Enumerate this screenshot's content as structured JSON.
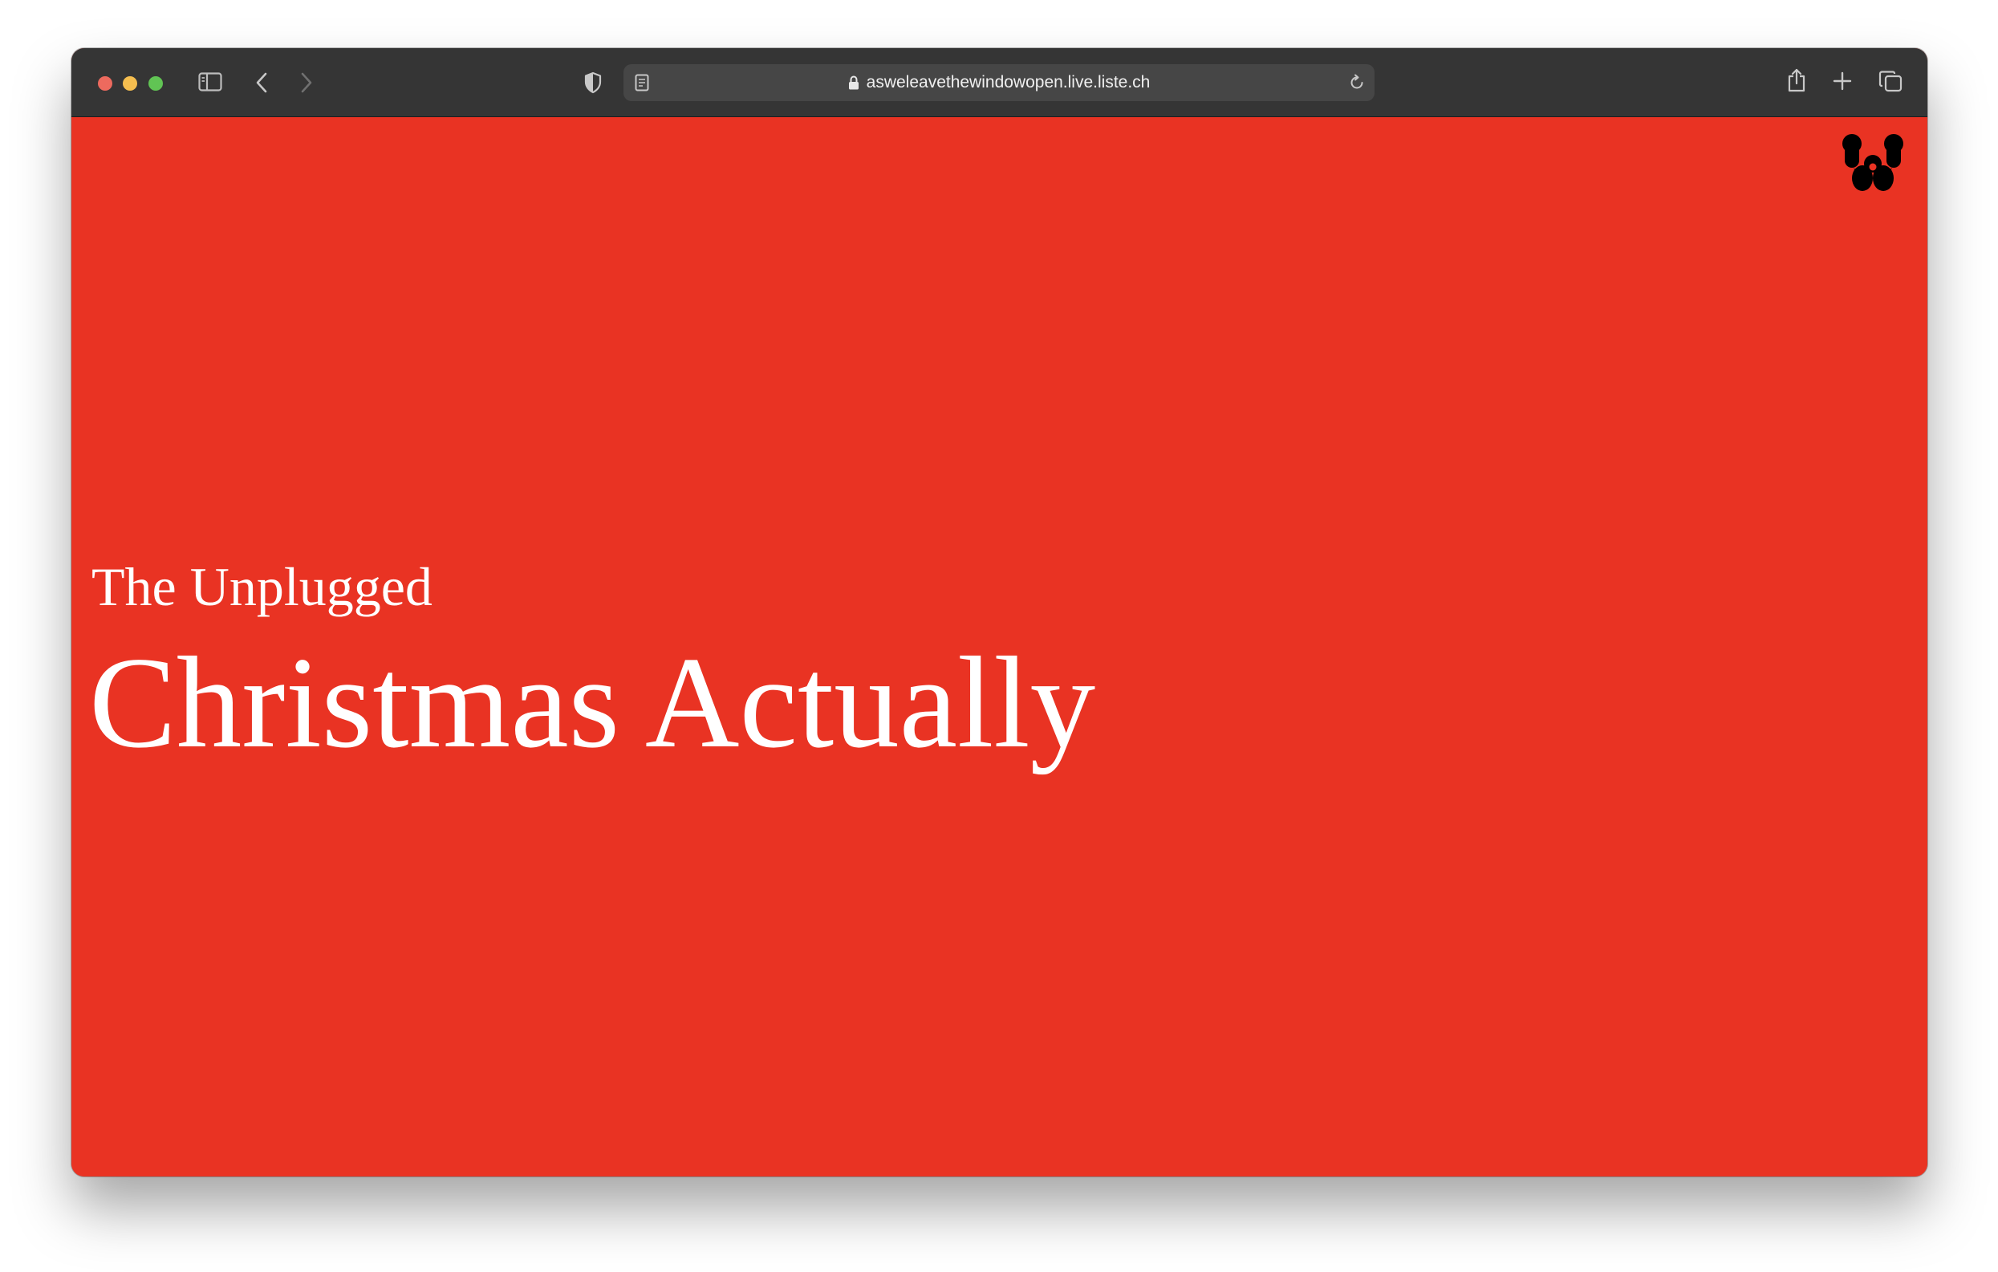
{
  "browser": {
    "url": "asweleavethewindowopen.live.liste.ch",
    "icons": {
      "sidebar": "sidebar-icon",
      "back": "chevron-left-icon",
      "forward": "chevron-right-icon",
      "privacy": "shield-icon",
      "reader": "reader-icon",
      "lock": "lock-icon",
      "reload": "reload-icon",
      "share": "share-icon",
      "new_tab": "plus-icon",
      "tabs": "tabs-overview-icon"
    }
  },
  "page": {
    "subtitle": "The Unplugged",
    "title": "Christmas Actually",
    "background_color": "#e93323",
    "logo_icon": "w-logo-icon"
  }
}
